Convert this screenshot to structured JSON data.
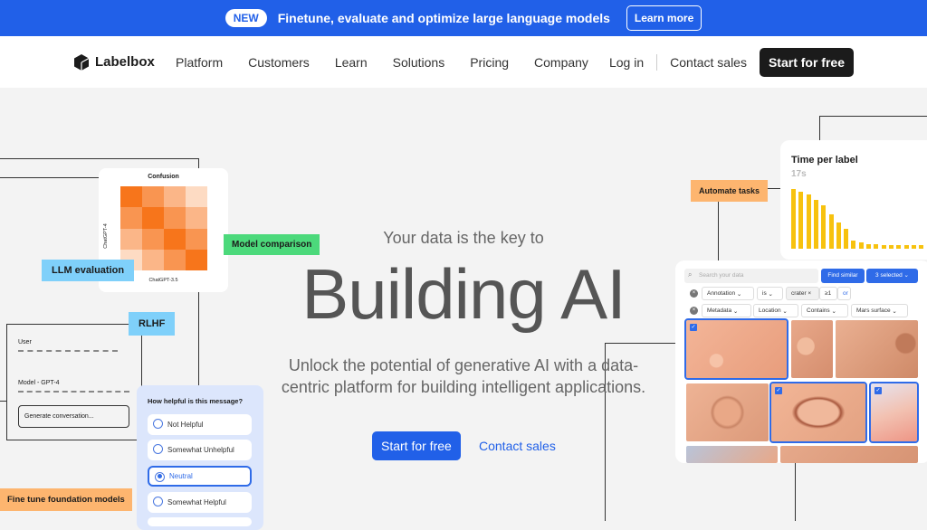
{
  "banner": {
    "badge": "NEW",
    "text": "Finetune, evaluate and optimize large language models",
    "button": "Learn more"
  },
  "nav": {
    "logo": "Labelbox",
    "links": [
      "Platform",
      "Customers",
      "Learn",
      "Solutions",
      "Pricing",
      "Company"
    ],
    "login": "Log in",
    "contact": "Contact sales",
    "start": "Start for free"
  },
  "hero": {
    "subtitle": "Your data is the key to",
    "title": "Building AI",
    "description_line1": "Unlock the potential of generative AI with a data-",
    "description_line2": "centric platform for building intelligent applications.",
    "cta_primary": "Start for free",
    "cta_secondary": "Contact sales"
  },
  "tags": {
    "llm_eval": "LLM evaluation",
    "model_comparison": "Model comparison",
    "rlhf": "RLHF",
    "fine_tune": "Fine tune foundation models",
    "automate": "Automate tasks"
  },
  "confusion": {
    "title": "Confusion",
    "ylabel": "ChatGPT-4",
    "xlabel": "ChatGPT-3.5",
    "matrix": [
      [
        4,
        3,
        2,
        1
      ],
      [
        3,
        4,
        3,
        2
      ],
      [
        2,
        3,
        4,
        3
      ],
      [
        1,
        2,
        3,
        4
      ]
    ]
  },
  "rlhf_card": {
    "user": "User",
    "model": "Model - GPT-4",
    "button": "Generate conversation..."
  },
  "helpful": {
    "question": "How helpful is this message?",
    "options": [
      "Not Helpful",
      "Somewhat Unhelpful",
      "Neutral",
      "Somewhat Helpful"
    ],
    "selected": "Neutral"
  },
  "time_chart": {
    "title": "Time per label",
    "value": "17s",
    "bars": [
      1.0,
      0.96,
      0.91,
      0.82,
      0.72,
      0.58,
      0.44,
      0.33,
      0.14,
      0.1,
      0.08,
      0.07,
      0.06,
      0.06,
      0.06,
      0.06,
      0.06,
      0.06
    ],
    "color": "#f7c20e"
  },
  "search_card": {
    "placeholder": "Search your data",
    "find_similar": "Find similar",
    "selected": "3 selected",
    "filter1": [
      "Annotation",
      "is",
      "crater",
      "≥1",
      "or"
    ],
    "filter2": [
      "Metadata",
      "Location",
      "Contains",
      "Mars surface"
    ]
  },
  "colors": {
    "accent": "#2160e8",
    "llm_tag": "#7fd0fa",
    "model_tag": "#4cd97b",
    "orange_tag": "#fdb56f"
  }
}
